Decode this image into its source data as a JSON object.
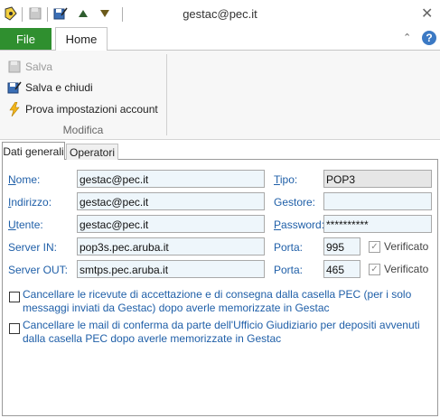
{
  "window": {
    "title": "gestac@pec.it"
  },
  "ribbon": {
    "tabs": {
      "file": "File",
      "home": "Home"
    },
    "buttons": {
      "save": "Salva",
      "save_close": "Salva e chiudi",
      "test_account": "Prova impostazioni account"
    },
    "group_label": "Modifica"
  },
  "tabs": {
    "general": "Dati generali",
    "operators": "Operatori"
  },
  "form": {
    "nome": {
      "label_ul": "N",
      "label_rest": "ome:",
      "value": "gestac@pec.it"
    },
    "indirizzo": {
      "label_ul": "I",
      "label_rest": "ndirizzo:",
      "value": "gestac@pec.it"
    },
    "utente": {
      "label_ul": "U",
      "label_rest": "tente:",
      "value": "gestac@pec.it"
    },
    "server_in": {
      "label": "Server IN:",
      "value": "pop3s.pec.aruba.it"
    },
    "server_out": {
      "label": "Server OUT:",
      "value": "smtps.pec.aruba.it"
    },
    "tipo": {
      "label_ul": "T",
      "label_rest": "ipo:",
      "value": "POP3"
    },
    "gestore": {
      "label": "Gestore:",
      "value": ""
    },
    "password": {
      "label_ul": "P",
      "label_rest": "assword:",
      "value": "**********"
    },
    "porta_in": {
      "label": "Porta:",
      "value": "995",
      "verified_label": "Verificato",
      "verified": true
    },
    "porta_out": {
      "label": "Porta:",
      "value": "465",
      "verified_label": "Verificato",
      "verified": true
    }
  },
  "options": {
    "cancel_receipts": "Cancellare le ricevute di accettazione e di consegna dalla casella PEC (per i solo messaggi inviati da Gestac) dopo averle memorizzate in Gestac",
    "cancel_confirm": "Cancellare le mail di conferma da parte dell'Ufficio Giudiziario per depositi avvenuti dalla casella PEC dopo averle memorizzate in Gestac"
  },
  "colors": {
    "file_tab": "#2f8f2f",
    "label_blue": "#1f5fa8",
    "field_bg": "#eef6fb"
  }
}
